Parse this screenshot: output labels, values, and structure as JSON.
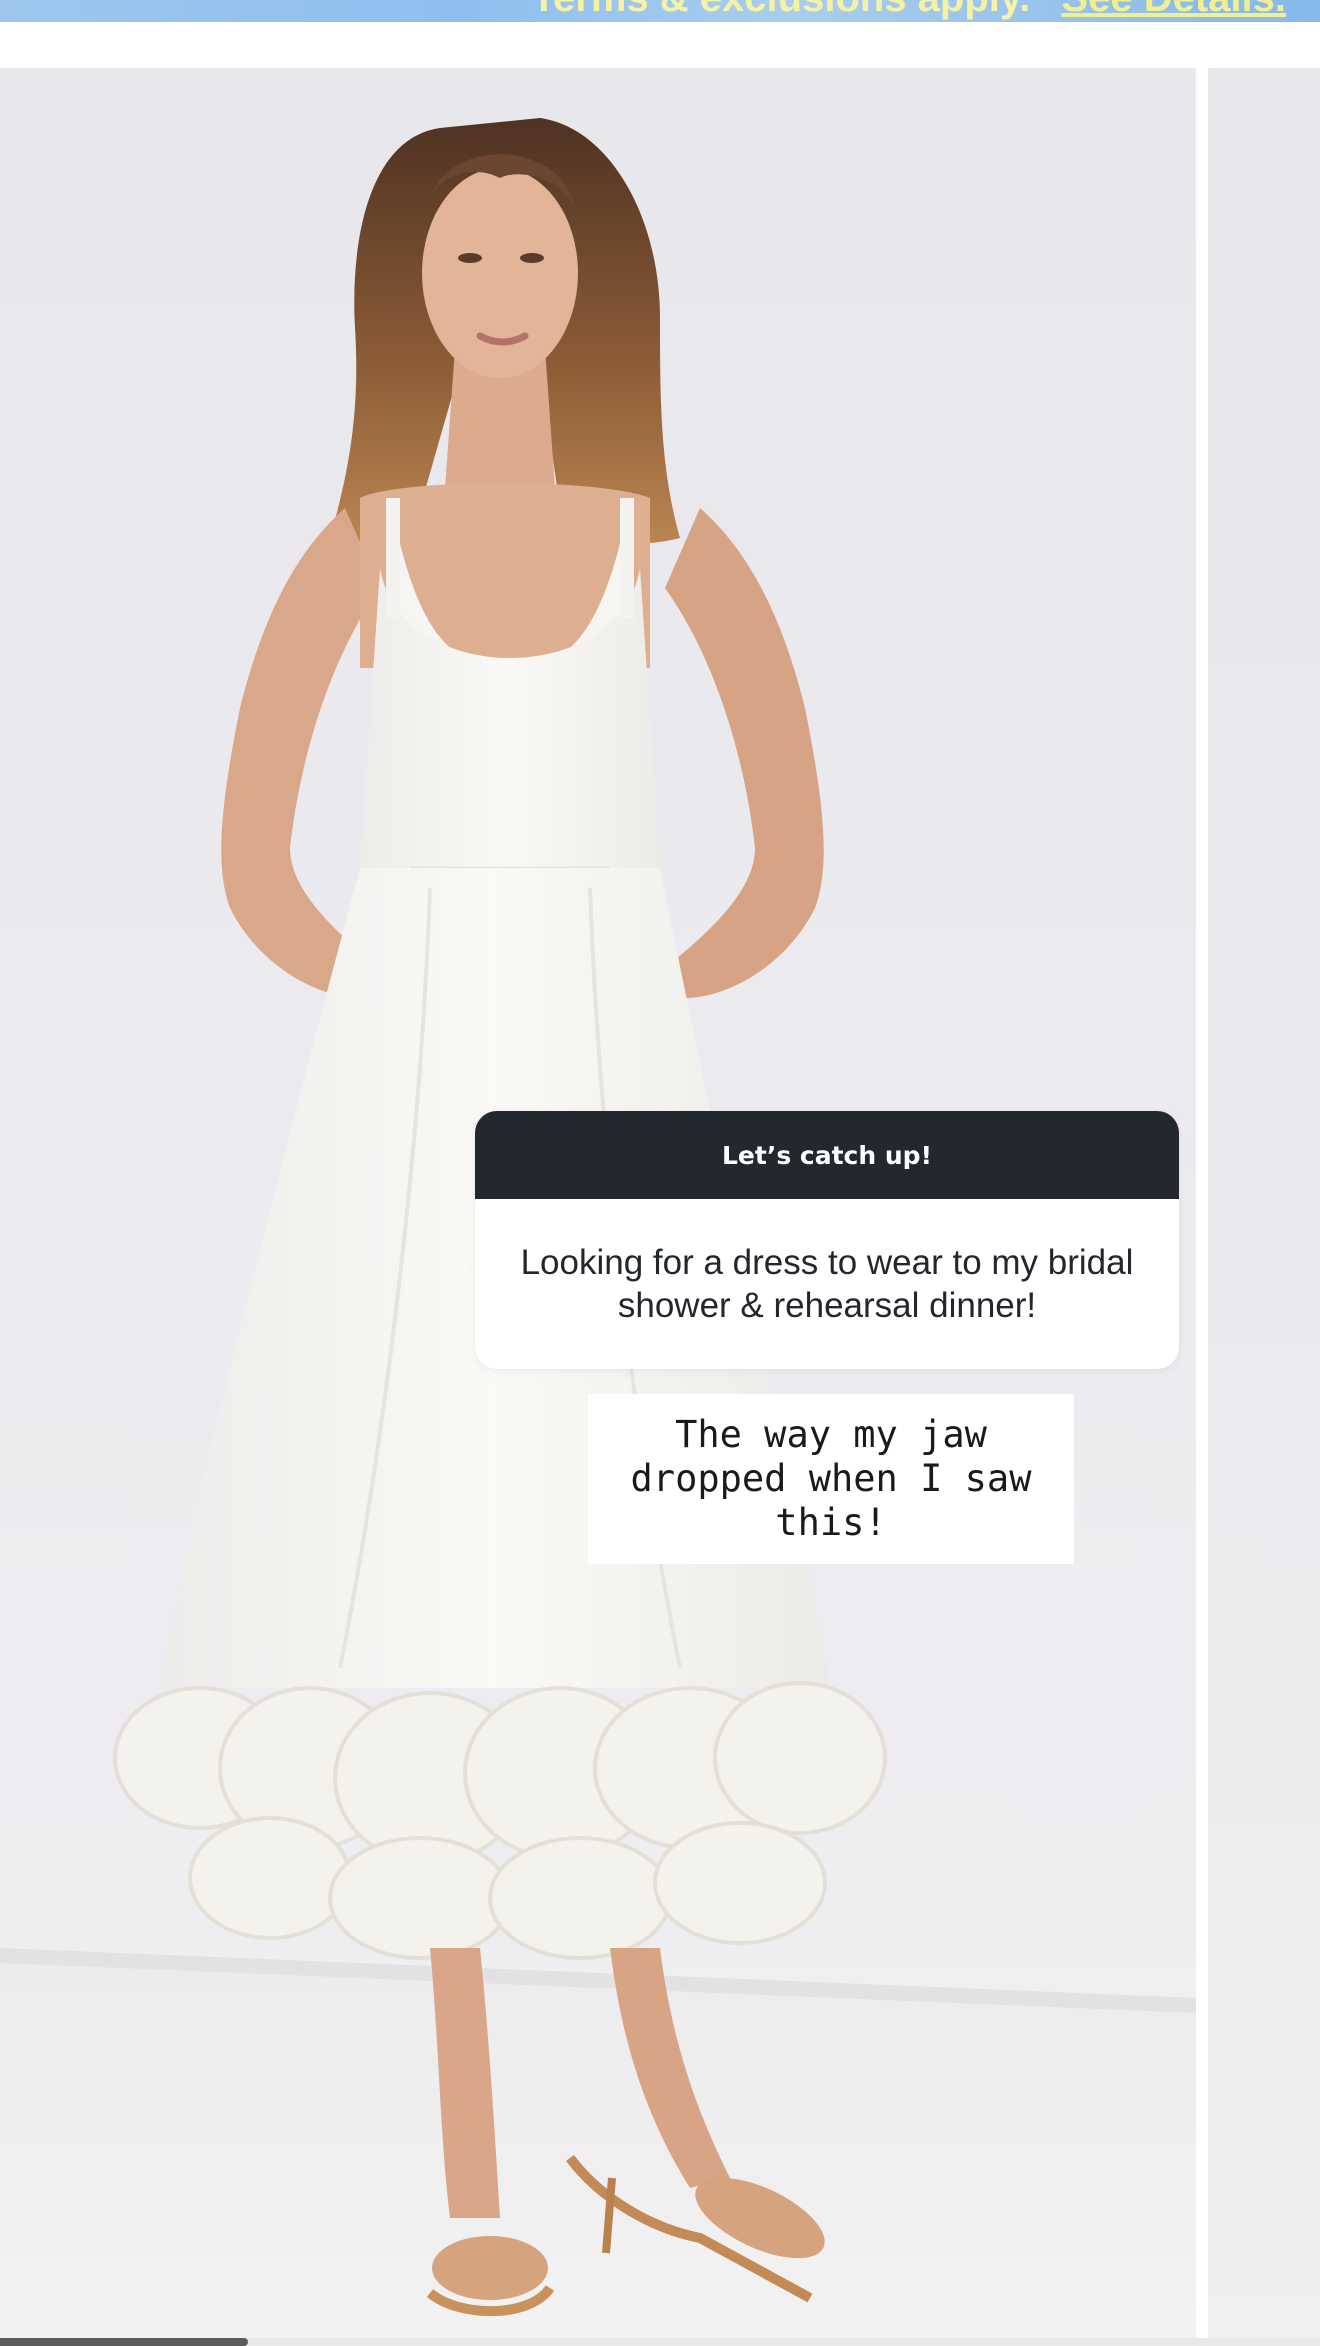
{
  "promo_banner": {
    "text": "Terms & exclusions apply.",
    "details_link": "See Details."
  },
  "story": {
    "header": "Let’s catch up!",
    "question": "Looking for a dress to wear to my bridal shower & rehearsal dinner!",
    "caption": "The way my jaw dropped when I saw this!"
  },
  "carousel": {
    "slide_count_visible": 2,
    "scroll_position": 0.19
  },
  "colors": {
    "card_header_bg": "#23272e",
    "card_header_text": "#ffffff",
    "banner_text": "#f5f2a6",
    "banner_bg": "#9cc6ec"
  }
}
